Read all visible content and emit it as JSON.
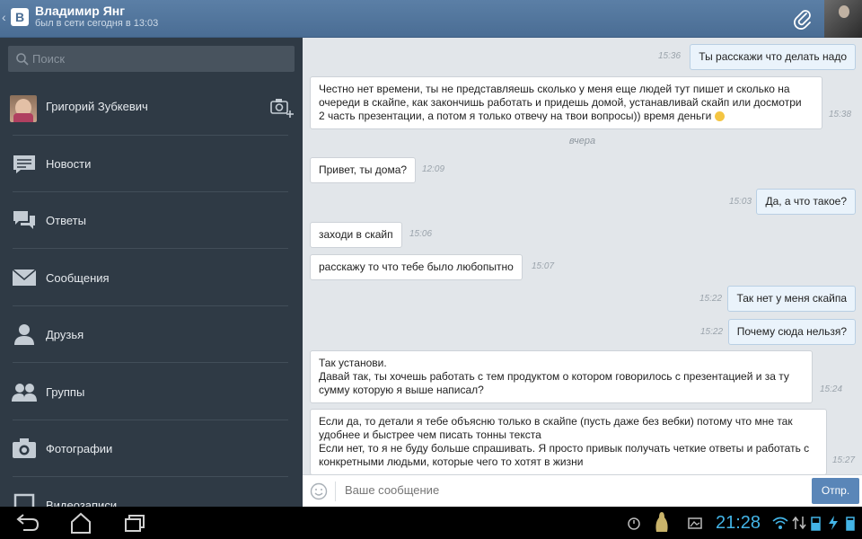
{
  "header": {
    "back": "‹",
    "logo": "В",
    "title": "Владимир Янг",
    "subtitle": "был в сети сегодня в 13:03",
    "attach_icon": "paperclip-icon"
  },
  "sidebar": {
    "search_placeholder": "Поиск",
    "profile_name": "Григорий Зубкевич",
    "items": [
      {
        "label": "Новости",
        "icon": "news-icon"
      },
      {
        "label": "Ответы",
        "icon": "replies-icon"
      },
      {
        "label": "Сообщения",
        "icon": "messages-icon"
      },
      {
        "label": "Друзья",
        "icon": "friends-icon"
      },
      {
        "label": "Группы",
        "icon": "groups-icon"
      },
      {
        "label": "Фотографии",
        "icon": "photos-icon"
      },
      {
        "label": "Видеозаписи",
        "icon": "videos-icon"
      }
    ]
  },
  "chat": {
    "day_divider": "вчера",
    "messages": [
      {
        "dir": "out",
        "text": "Ты расскажи что делать надо",
        "time": "15:36"
      },
      {
        "dir": "in",
        "text": "Честно нет времени, ты не представляешь сколько у меня еще людей тут пишет и сколько на\nочереди в скайпе, как закончишь работать и придешь домой, устанавливай скайп или досмотри\n2 часть презентации, а потом я только отвечу на твои вопросы)) время деньги",
        "time": "15:38"
      },
      {
        "dir": "in",
        "text": "Привет, ты дома?",
        "time": "12:09"
      },
      {
        "dir": "out",
        "text": "Да, а что такое?",
        "time": "15:03"
      },
      {
        "dir": "in",
        "text": "заходи в скайп",
        "time": "15:06"
      },
      {
        "dir": "in",
        "text": "расскажу то что тебе было любопытно",
        "time": "15:07"
      },
      {
        "dir": "out",
        "text": "Так нет у меня скайпа",
        "time": "15:22"
      },
      {
        "dir": "out",
        "text": "Почему сюда нельзя?",
        "time": "15:22"
      },
      {
        "dir": "in",
        "text": "Так установи.\nДавай так, ты хочешь работать с тем продуктом о котором говорилось с презентацией и за ту\nсумму которую я выше написал?",
        "time": "15:24"
      },
      {
        "dir": "in",
        "text": "Если да, то детали я тебе объясню только в скайпе (пусть даже без вебки) потому что мне так\nудобнее и быстрее чем писать тонны текста\nЕсли нет, то я не буду больше спрашивать. Я просто привык получать четкие ответы и работать с\nконкретными людьми, которые чего то хотят в жизни",
        "time": "15:27"
      }
    ]
  },
  "composer": {
    "placeholder": "Ваше сообщение",
    "send_label": "Отпр."
  },
  "statusbar": {
    "time": "21:28"
  },
  "colors": {
    "header": "#4a6d94",
    "sidebar": "#2f3a45",
    "chat_bg": "#e2e6ea",
    "clock": "#43b4e6",
    "send": "#5a86b8"
  }
}
